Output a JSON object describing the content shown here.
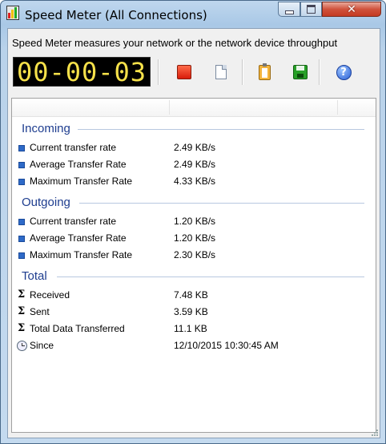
{
  "window": {
    "title": "Speed Meter (All Connections)",
    "close_glyph": "✕"
  },
  "description": "Speed Meter measures your network or the network device throughput",
  "toolbar": {
    "counter": "00-00-03",
    "buttons": [
      "stop-icon",
      "new-document-icon",
      "clipboard-icon",
      "save-icon",
      "help-icon"
    ],
    "help_glyph": "?"
  },
  "groups": {
    "incoming": {
      "title": "Incoming",
      "rows": [
        {
          "label": "Current transfer rate",
          "value": "2.49 KB/s"
        },
        {
          "label": "Average Transfer Rate",
          "value": "2.49 KB/s"
        },
        {
          "label": "Maximum Transfer Rate",
          "value": "4.33 KB/s"
        }
      ]
    },
    "outgoing": {
      "title": "Outgoing",
      "rows": [
        {
          "label": "Current transfer rate",
          "value": "1.20 KB/s"
        },
        {
          "label": "Average Transfer Rate",
          "value": "1.20 KB/s"
        },
        {
          "label": "Maximum Transfer Rate",
          "value": "2.30 KB/s"
        }
      ]
    },
    "total": {
      "title": "Total",
      "sigma": "Σ",
      "rows": [
        {
          "label": "Received",
          "value": "7.48 KB"
        },
        {
          "label": "Sent",
          "value": "3.59 KB"
        },
        {
          "label": "Total Data Transferred",
          "value": "11.1 KB"
        },
        {
          "label": "Since",
          "value": "12/10/2015 10:30:45 AM"
        }
      ]
    }
  },
  "colors": {
    "group_title": "#1e3d8f",
    "bullet": "#2e6ac8",
    "counter_digits": "#f6e14a",
    "counter_bg": "#000000"
  }
}
